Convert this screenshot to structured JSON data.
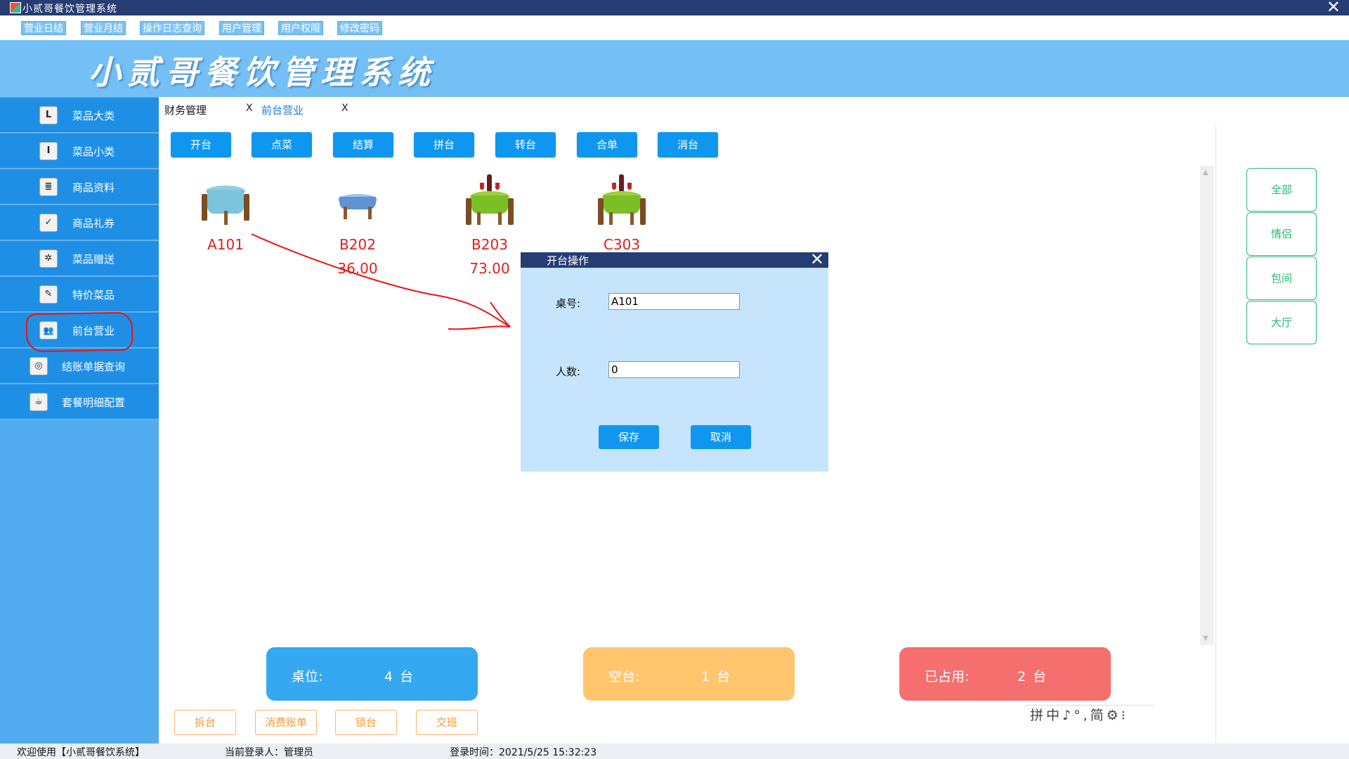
{
  "window": {
    "title": "小贰哥餐饮管理系统",
    "close_glyph": "✕"
  },
  "menu": [
    "营业日结",
    "营业月结",
    "操作日志查询",
    "用户管理",
    "用户权限",
    "修改密码"
  ],
  "banner": {
    "title": "小贰哥餐饮管理系统"
  },
  "sidebar": {
    "items": [
      {
        "label": "菜品大类",
        "icon": "letter-l-icon",
        "glyph": "L"
      },
      {
        "label": "菜品小类",
        "icon": "letter-i-icon",
        "glyph": "I"
      },
      {
        "label": "商品资料",
        "icon": "list-document-icon",
        "glyph": "≣"
      },
      {
        "label": "商品礼券",
        "icon": "checkbox-icon",
        "glyph": "✓"
      },
      {
        "label": "菜品赠送",
        "icon": "gear-dial-icon",
        "glyph": "✲"
      },
      {
        "label": "特价菜品",
        "icon": "tag-tools-icon",
        "glyph": "✎"
      },
      {
        "label": "前台营业",
        "icon": "users-icon",
        "glyph": "👥"
      },
      {
        "label": "结账单据查询",
        "icon": "swirl-icon",
        "glyph": "◎"
      },
      {
        "label": "套餐明细配置",
        "icon": "coffee-cup-icon",
        "glyph": "☕"
      }
    ]
  },
  "tabs": [
    {
      "label": "财务管理",
      "close": "X"
    },
    {
      "label": "前台营业",
      "close": "X"
    }
  ],
  "toolbar": [
    "开台",
    "点菜",
    "结算",
    "拼台",
    "转台",
    "合单",
    "消台"
  ],
  "tables": [
    {
      "name": "A101",
      "amount": "",
      "status": "free",
      "icon": "empty-table-icon"
    },
    {
      "name": "B202",
      "amount": "36.00",
      "status": "occupied",
      "icon": "table-blue-cloth-icon"
    },
    {
      "name": "B203",
      "amount": "73.00",
      "status": "occupied",
      "icon": "table-with-wine-icon"
    },
    {
      "name": "C303",
      "amount": "",
      "status": "occupied",
      "icon": "table-with-wine-icon"
    }
  ],
  "filters": [
    "全部",
    "情侣",
    "包间",
    "大厅"
  ],
  "stats": [
    {
      "label": "桌位:",
      "value": "4 台",
      "color": "#35a8f2"
    },
    {
      "label": "空台:",
      "value": "1 台",
      "color": "#ffc66e"
    },
    {
      "label": "已占用:",
      "value": "2 台",
      "color": "#f56f6e"
    }
  ],
  "bottom_buttons": [
    "拆台",
    "消费账单",
    "锁台",
    "交班"
  ],
  "ime": {
    "text": "拼中♪°,简⚙⁝"
  },
  "status": {
    "welcome": "欢迎使用【小贰哥餐饮系统】",
    "user": "当前登录人：管理员",
    "login_time": "登录时间：2021/5/25 15:32:23"
  },
  "dialog": {
    "title": "开台操作",
    "close_glyph": "✕",
    "table_label": "桌号:",
    "table_value": "A101",
    "people_label": "人数:",
    "people_value": "0",
    "save": "保存",
    "cancel": "取消"
  },
  "colors": {
    "accent": "#0f97f0",
    "sidebar": "#1f8fe6",
    "banner": "#74c0f6",
    "titlebar": "#253d72",
    "annotation": "#e11"
  }
}
